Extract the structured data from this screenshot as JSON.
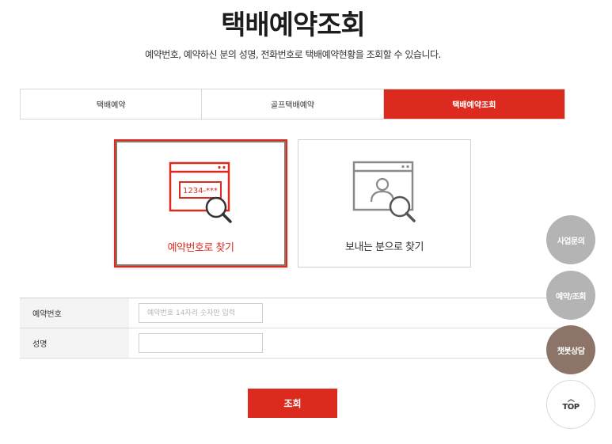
{
  "page": {
    "title": "택배예약조회",
    "subtitle": "예약번호, 예약하신 분의 성명, 전화번호로 택배예약현황을 조회할 수 있습니다."
  },
  "tabs": [
    {
      "label": "택배예약",
      "active": false
    },
    {
      "label": "골프택배예약",
      "active": false
    },
    {
      "label": "택배예약조회",
      "active": true
    }
  ],
  "search_options": {
    "by_number": {
      "label": "예약번호로 찾기",
      "icon_text": "1234-***",
      "selected": true,
      "icon": "browser-number-search-icon"
    },
    "by_sender": {
      "label": "보내는 분으로 찾기",
      "selected": false,
      "icon": "browser-person-search-icon"
    }
  },
  "form": {
    "reservation_number": {
      "label": "예약번호",
      "placeholder": "예약번호 14자리 숫자만 입력",
      "value": ""
    },
    "name": {
      "label": "성명",
      "placeholder": "",
      "value": ""
    }
  },
  "submit_label": "조회",
  "floating": {
    "business": "사업문의",
    "reservation": "예약/조회",
    "chatbot": "챗봇상담",
    "top": "TOP",
    "top_icon": "chevron-up-icon"
  },
  "colors": {
    "accent": "#dd2a1f",
    "chatbot": "#8c7568",
    "floating_gray": "#b4b4b4"
  }
}
